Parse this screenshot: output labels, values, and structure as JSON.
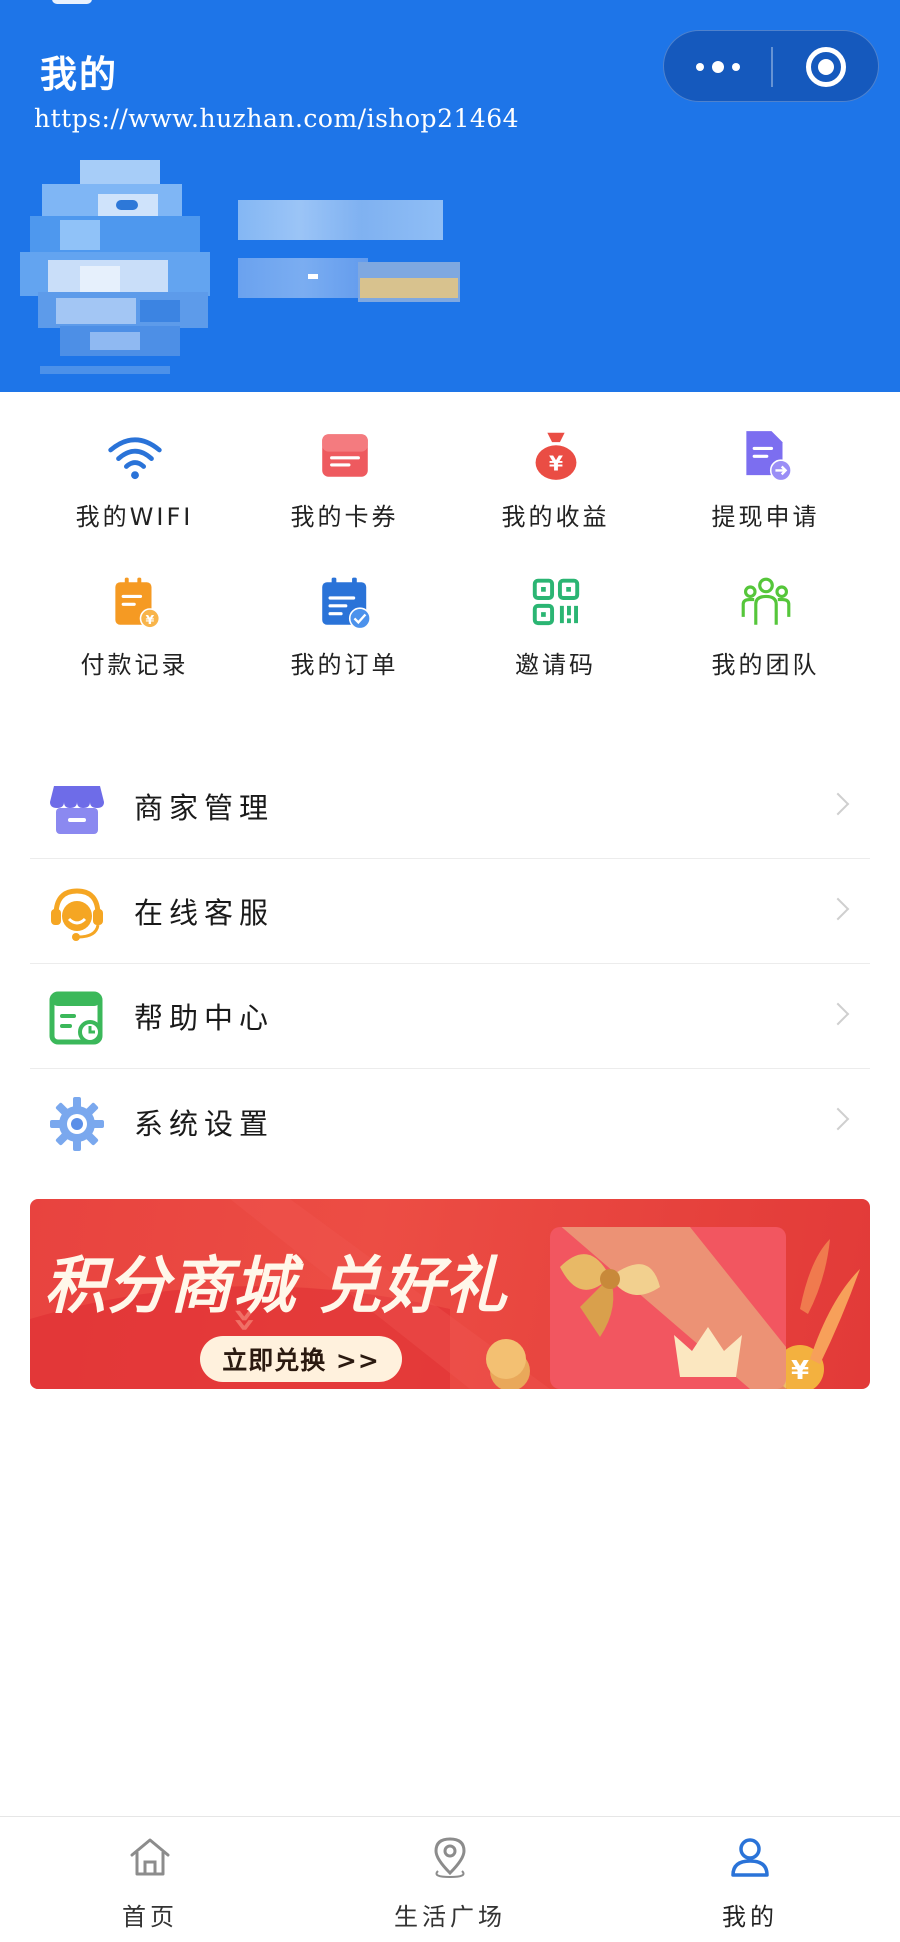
{
  "header": {
    "title": "我的",
    "watermark": "https://www.huzhan.com/ishop21464",
    "background_color": "#1e75e8",
    "capsule": {
      "more_icon": "more-dots-icon",
      "close_icon": "target-circle-icon"
    }
  },
  "user": {
    "avatar_icon": "pixelated-avatar-icon",
    "name_censored": true
  },
  "grid": [
    {
      "label": "我的WIFI",
      "icon": "wifi-icon",
      "color": "#2a73d8"
    },
    {
      "label": "我的卡券",
      "icon": "coupon-card-icon",
      "color": "#ee5a5f"
    },
    {
      "label": "我的收益",
      "icon": "money-bag-icon",
      "color": "#ea4d44"
    },
    {
      "label": "提现申请",
      "icon": "withdraw-document-icon",
      "color": "#7c6ef0"
    },
    {
      "label": "付款记录",
      "icon": "payment-record-icon",
      "color": "#f59a23"
    },
    {
      "label": "我的订单",
      "icon": "order-calendar-icon",
      "color": "#2a73d8"
    },
    {
      "label": "邀请码",
      "icon": "qr-code-icon",
      "color": "#2bb573"
    },
    {
      "label": "我的团队",
      "icon": "team-icon",
      "color": "#55c63a"
    }
  ],
  "menu": [
    {
      "label": "商家管理",
      "icon": "shop-icon",
      "color": "#6e6ce8"
    },
    {
      "label": "在线客服",
      "icon": "customer-service-icon",
      "color": "#f5a623"
    },
    {
      "label": "帮助中心",
      "icon": "help-center-icon",
      "color": "#3bb85a"
    },
    {
      "label": "系统设置",
      "icon": "settings-gear-icon",
      "color": "#5b8fe8"
    }
  ],
  "banner": {
    "headline": "积分商城  兑好礼",
    "cta": "立即兑换 >>",
    "background_color": "#e8433f"
  },
  "tabbar": [
    {
      "label": "首页",
      "icon": "home-icon",
      "active": false
    },
    {
      "label": "生活广场",
      "icon": "location-pin-icon",
      "active": false
    },
    {
      "label": "我的",
      "icon": "user-icon",
      "active": true
    }
  ],
  "accent_color": "#2a73d8"
}
